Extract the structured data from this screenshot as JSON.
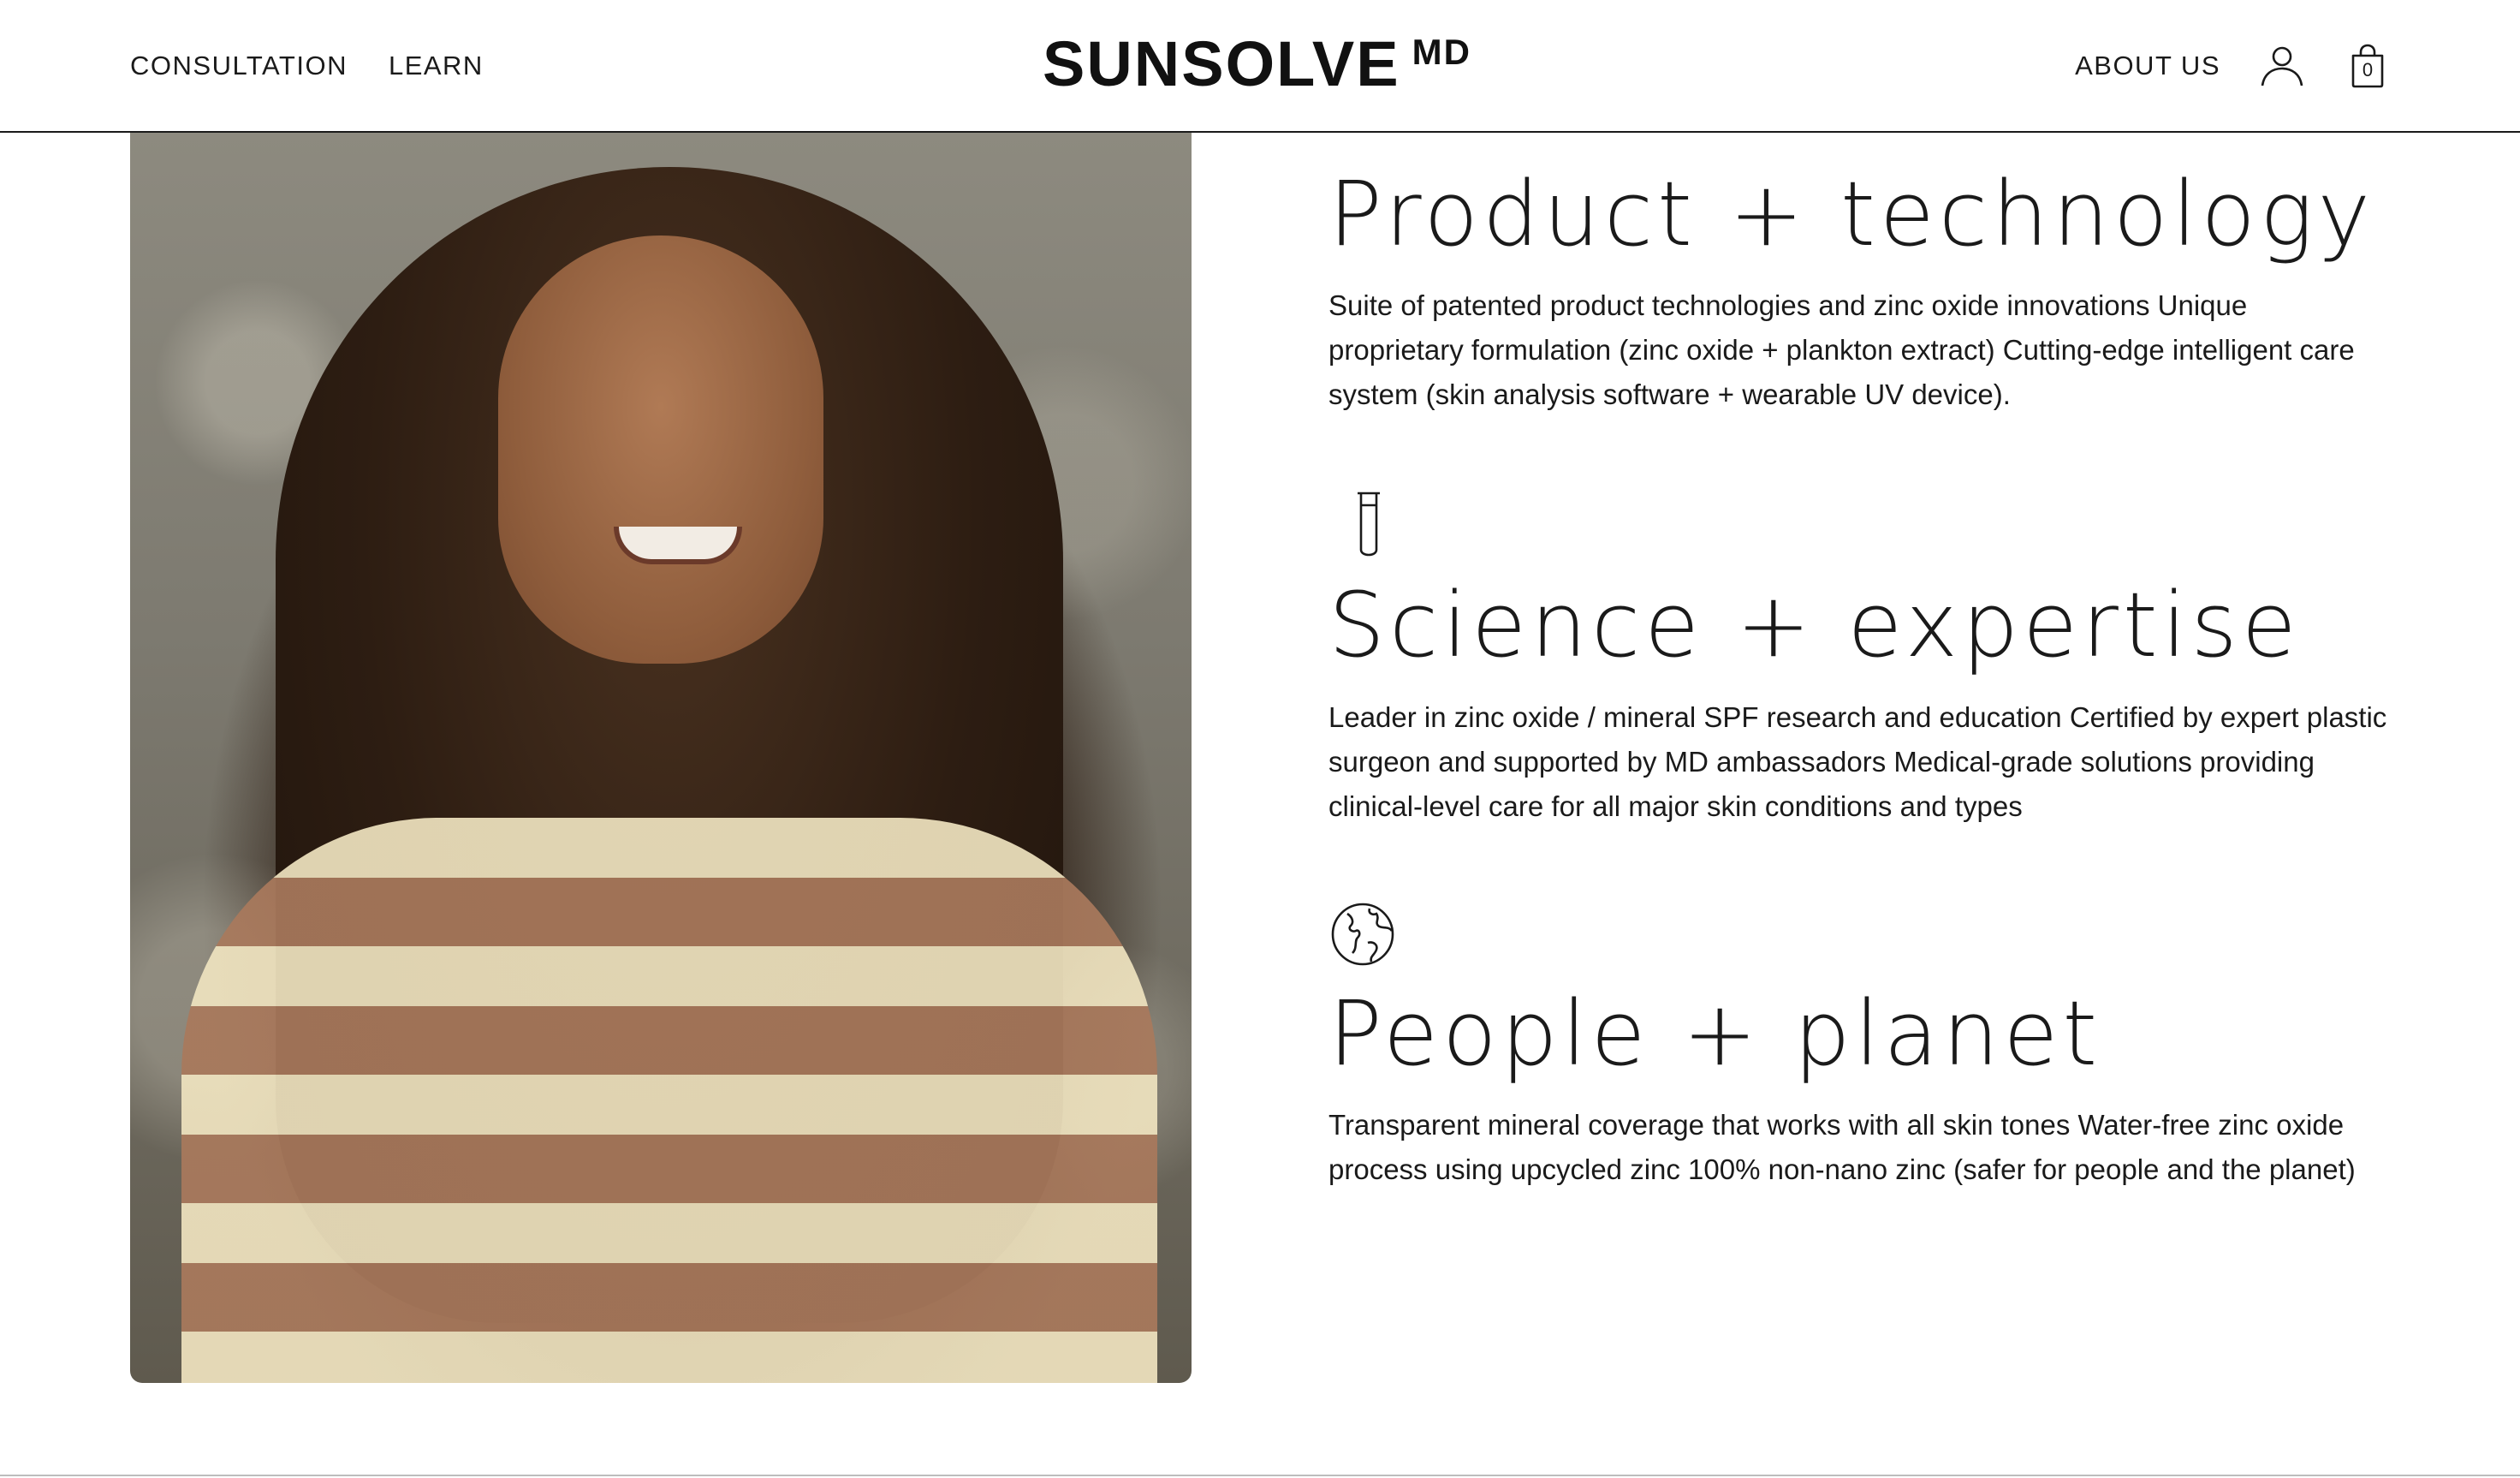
{
  "header": {
    "nav_left": [
      {
        "label": "CONSULTATION"
      },
      {
        "label": "LEARN"
      }
    ],
    "logo": {
      "main": "SUNSOLVE",
      "sup": "MD"
    },
    "nav_right": {
      "about_label": "ABOUT US",
      "account_icon": "user-icon",
      "cart_icon": "shopping-bag-icon",
      "cart_count": "0"
    }
  },
  "hero": {
    "image_subject": "smiling woman with long curly hair in striped sweater"
  },
  "features": [
    {
      "icon": "none",
      "title": "Product + technology",
      "body": "Suite of patented product technologies and zinc oxide innovations Unique proprietary formulation (zinc oxide + plankton extract) Cutting-edge intelligent care system (skin analysis software + wearable UV device)."
    },
    {
      "icon": "test-tube-icon",
      "title": "Science + expertise",
      "body": "Leader in zinc oxide / mineral SPF research and education Certified by expert plastic surgeon and supported by MD ambassadors Medical-grade solutions providing clinical-level care for all major skin conditions and types"
    },
    {
      "icon": "globe-icon",
      "title": "People + planet",
      "body": "Transparent mineral coverage that works with all skin tones Water-free zinc oxide process using upcycled zinc 100% non-nano zinc (safer for people and the planet)"
    }
  ],
  "colors": {
    "text": "#1a1a1a",
    "background": "#ffffff",
    "rule": "#1a1a1a"
  }
}
